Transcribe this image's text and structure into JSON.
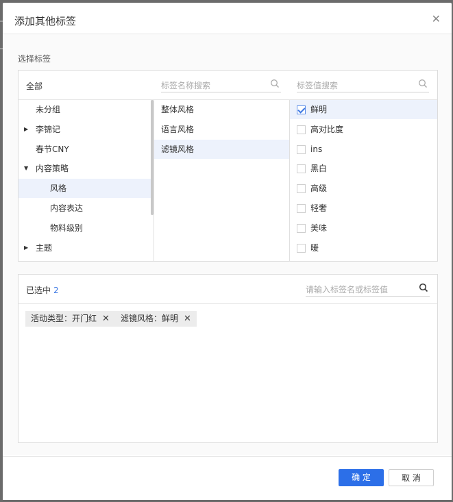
{
  "dialog": {
    "title": "添加其他标签"
  },
  "section_label": "选择标签",
  "panel": {
    "all_label": "全部",
    "name_search_placeholder": "标签名称搜索",
    "value_search_placeholder": "标签值搜索",
    "categories": [
      {
        "label": "未分组",
        "expandable": false,
        "indent": 0
      },
      {
        "label": "李锦记",
        "expandable": true,
        "expanded": false,
        "indent": 0
      },
      {
        "label": "春节CNY",
        "expandable": false,
        "indent": 0
      },
      {
        "label": "内容策略",
        "expandable": true,
        "expanded": true,
        "indent": 0
      },
      {
        "label": "风格",
        "expandable": false,
        "indent": 1,
        "selected": true
      },
      {
        "label": "内容表达",
        "expandable": false,
        "indent": 1
      },
      {
        "label": "物料级别",
        "expandable": false,
        "indent": 1
      },
      {
        "label": "主题",
        "expandable": true,
        "expanded": false,
        "indent": 0
      }
    ],
    "names": [
      {
        "label": "整体风格"
      },
      {
        "label": "语言风格"
      },
      {
        "label": "滤镜风格",
        "selected": true
      }
    ],
    "values": [
      {
        "label": "鲜明",
        "checked": true
      },
      {
        "label": "高对比度",
        "checked": false
      },
      {
        "label": "ins",
        "checked": false
      },
      {
        "label": "黑白",
        "checked": false
      },
      {
        "label": "高级",
        "checked": false
      },
      {
        "label": "轻奢",
        "checked": false
      },
      {
        "label": "美味",
        "checked": false
      },
      {
        "label": "暖",
        "checked": false
      }
    ]
  },
  "selected": {
    "label": "已选中",
    "count": "2",
    "search_placeholder": "请输入标签名或标签值",
    "chips": [
      {
        "label": "活动类型：开门红"
      },
      {
        "label": "滤镜风格：鲜明"
      }
    ]
  },
  "footer": {
    "ok_label": "确 定",
    "cancel_label": "取 消"
  },
  "colors": {
    "primary": "#2c6fe8",
    "selected_row": "#edf2fc"
  }
}
